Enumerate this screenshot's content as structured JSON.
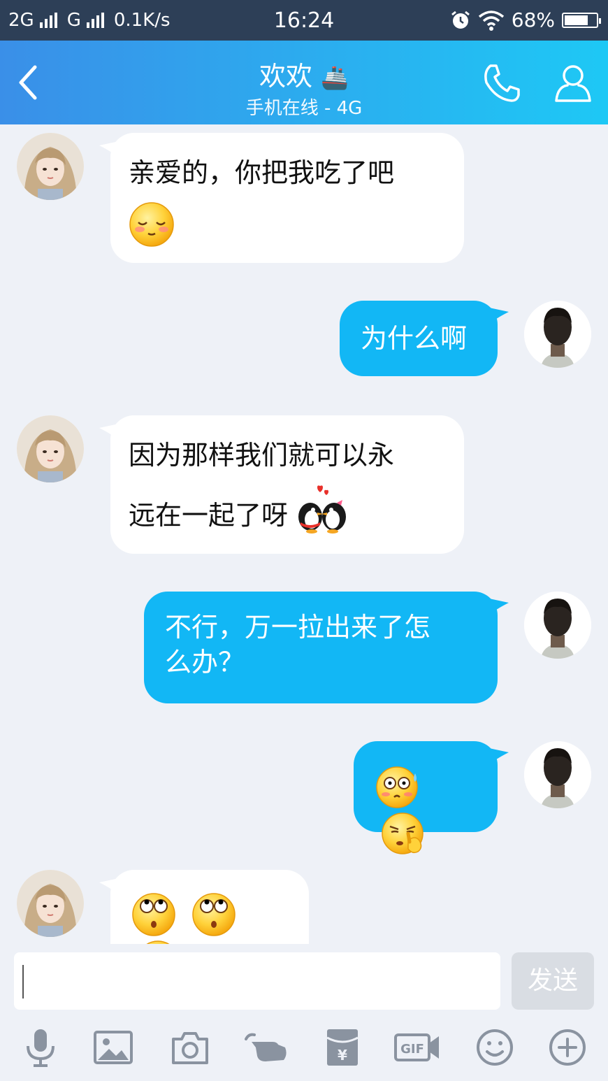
{
  "status_bar": {
    "network1": "2G",
    "network2": "G",
    "speed": "0.1K/s",
    "time": "16:24",
    "battery": "68%",
    "battery_level": 0.68
  },
  "header": {
    "title": "欢欢",
    "title_emoji": "🚢",
    "subtitle": "手机在线 - 4G"
  },
  "messages": [
    {
      "side": "left",
      "line1": "亲爱的，你把我吃了吧",
      "emoji": "shy-blush-emoji"
    },
    {
      "side": "right",
      "text": "为什么啊"
    },
    {
      "side": "left",
      "line1": "因为那样我们就可以永",
      "line2": "远在一起了呀",
      "emoji": "kissing-penguins-emoji"
    },
    {
      "side": "right",
      "line1": "不行，万一拉出来了怎",
      "line2": "么办？"
    },
    {
      "side": "right",
      "emojis": [
        "scared-sweat-emoji",
        "pick-nose-emoji"
      ]
    },
    {
      "side": "left",
      "emojis": [
        "eye-roll-emoji",
        "eye-roll-emoji",
        "eye-roll-emoji"
      ]
    }
  ],
  "input": {
    "placeholder": "",
    "send_label": "发送"
  },
  "toolbar": [
    "microphone-icon",
    "image-icon",
    "camera-icon",
    "poke-hand-icon",
    "red-packet-icon",
    "gif-icon",
    "emoji-smile-icon",
    "plus-icon"
  ],
  "colors": {
    "status_bar_bg": "#2d3f57",
    "header_gradient_start": "#3a8fe8",
    "header_gradient_end": "#1ec8f5",
    "outgoing_bubble": "#12b7f5",
    "incoming_bubble": "#ffffff",
    "chat_bg": "#eef1f7"
  }
}
